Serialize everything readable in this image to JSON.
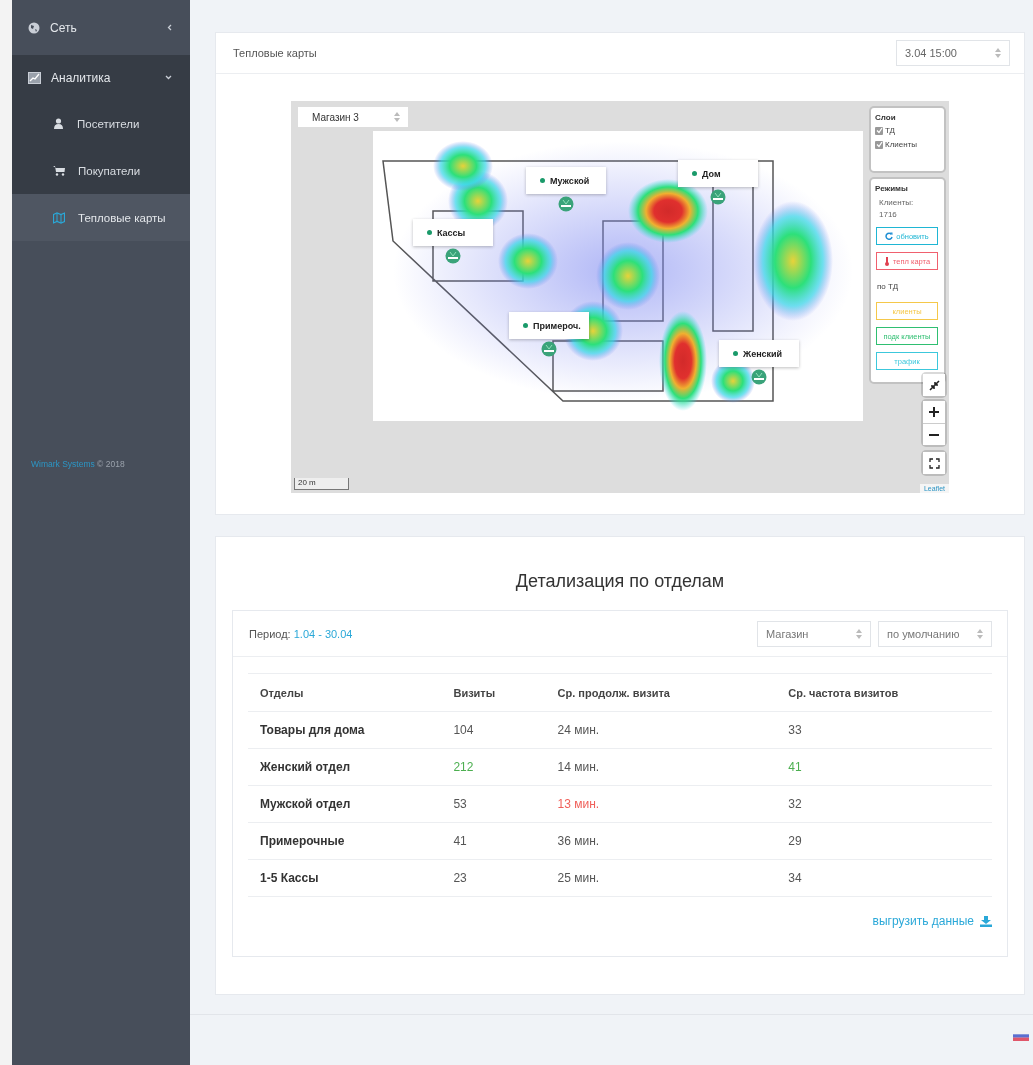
{
  "sidebar": {
    "items": [
      {
        "label": "Сеть",
        "expanded": false,
        "selected": false
      },
      {
        "label": "Аналитика",
        "expanded": true,
        "selected": false,
        "children": [
          {
            "label": "Посетители",
            "selected": false
          },
          {
            "label": "Покупатели",
            "selected": false
          },
          {
            "label": "Тепловые карты",
            "selected": true
          }
        ]
      }
    ],
    "footer": {
      "link": "Wimark Systems",
      "text": "© 2018"
    }
  },
  "heatmap_card": {
    "title": "Тепловые карты",
    "time_select": "3.04 15:00",
    "map": {
      "store_select": "Магазин 3",
      "markers": [
        {
          "label": "Кассы"
        },
        {
          "label": "Мужской"
        },
        {
          "label": "Дом"
        },
        {
          "label": "Примероч."
        },
        {
          "label": "Женский"
        }
      ],
      "layers": {
        "title": "Слои",
        "items": [
          {
            "label": "ТД",
            "checked": true
          },
          {
            "label": "Клиенты",
            "checked": true
          }
        ]
      },
      "modes": {
        "title": "Режимы",
        "clients_label": "Клиенты:",
        "clients_count": "1716",
        "actions": [
          {
            "label": "обновить",
            "kind": "refresh",
            "color": "#1fb6d4"
          },
          {
            "label": "тепл карта",
            "kind": "heat",
            "color": "#f0606e"
          }
        ],
        "subtitle": "по ТД",
        "views": [
          {
            "label": "клиенты",
            "color": "#f5c84a"
          },
          {
            "label": "подк клиенты",
            "color": "#2fbf71"
          },
          {
            "label": "трафик",
            "color": "#3cc8dc"
          }
        ]
      },
      "scale": "20 m",
      "attribution": "Leaflet"
    }
  },
  "detail_card": {
    "title": "Детализация по отделам",
    "period_label": "Период:",
    "period": "1.04 - 30.04",
    "selects": [
      "Магазин",
      "по умолчанию"
    ],
    "table": {
      "columns": [
        "Отделы",
        "Визиты",
        "Ср. продолж. визита",
        "Ср. частота визитов"
      ],
      "rows": [
        {
          "cells": [
            {
              "text": "Товары для дома",
              "color": "#333333"
            },
            {
              "text": "104",
              "color": "#555555"
            },
            {
              "text": "24 мин.",
              "color": "#555555"
            },
            {
              "text": "33",
              "color": "#555555"
            }
          ]
        },
        {
          "cells": [
            {
              "text": "Женский отдел",
              "color": "#333333"
            },
            {
              "text": "212",
              "color": "#4caf50"
            },
            {
              "text": "14 мин.",
              "color": "#555555"
            },
            {
              "text": "41",
              "color": "#4caf50"
            }
          ]
        },
        {
          "cells": [
            {
              "text": "Мужской отдел",
              "color": "#333333"
            },
            {
              "text": "53",
              "color": "#555555"
            },
            {
              "text": "13 мин.",
              "color": "#f0605a"
            },
            {
              "text": "32",
              "color": "#555555"
            }
          ]
        },
        {
          "cells": [
            {
              "text": "Примерочные",
              "color": "#333333"
            },
            {
              "text": "41",
              "color": "#555555"
            },
            {
              "text": "36 мин.",
              "color": "#555555"
            },
            {
              "text": "29",
              "color": "#555555"
            }
          ]
        },
        {
          "cells": [
            {
              "text": "1-5 Кассы",
              "color": "#333333"
            },
            {
              "text": "23",
              "color": "#555555"
            },
            {
              "text": "25 мин.",
              "color": "#555555"
            },
            {
              "text": "34",
              "color": "#555555"
            }
          ]
        }
      ]
    },
    "export": "выгрузить данные"
  }
}
